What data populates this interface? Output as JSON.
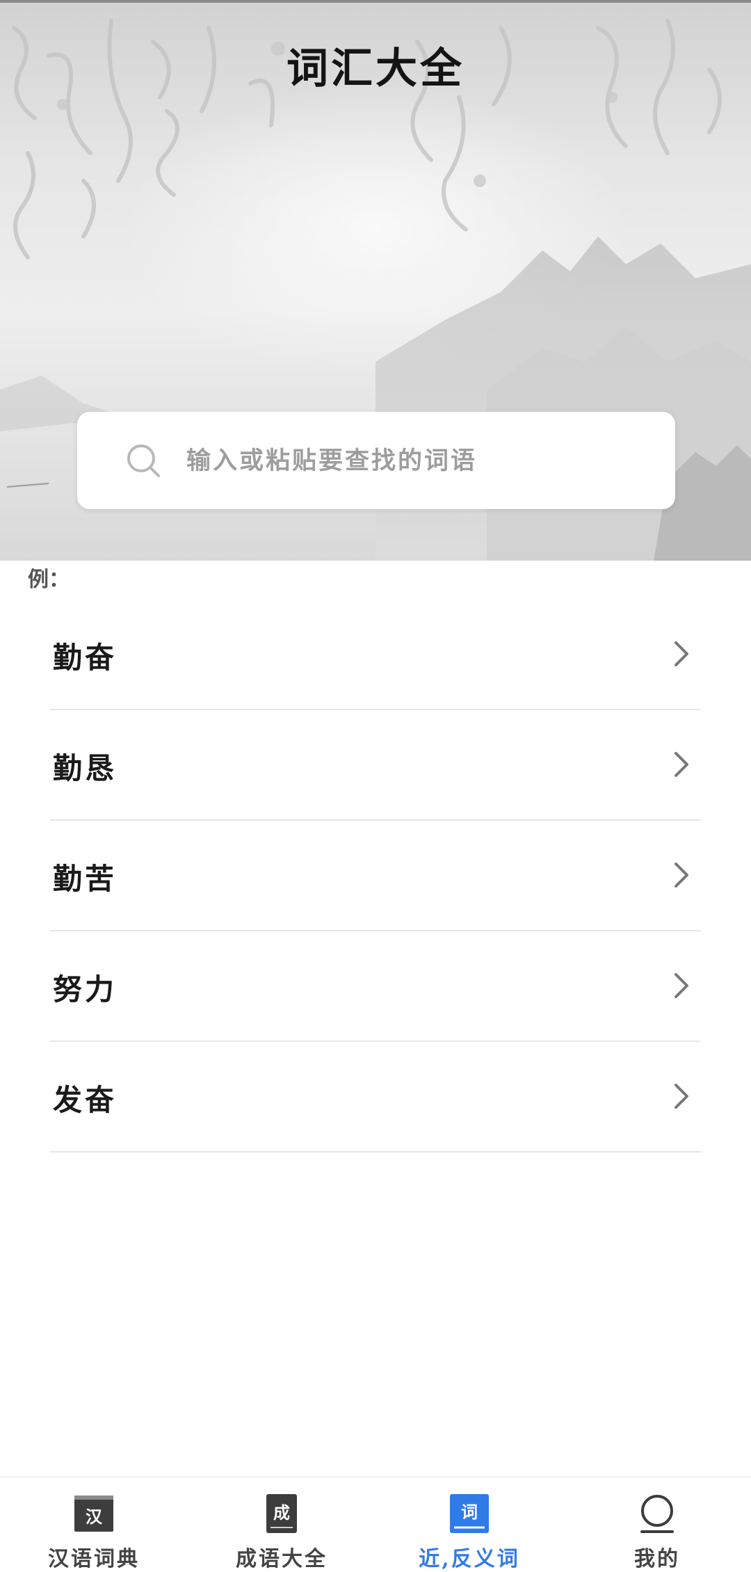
{
  "header": {
    "title": "词汇大全"
  },
  "search": {
    "placeholder": "输入或粘贴要查找的词语"
  },
  "examples": {
    "label": "例：",
    "items": [
      {
        "word": "勤奋"
      },
      {
        "word": "勤恳"
      },
      {
        "word": "勤苦"
      },
      {
        "word": "努力"
      },
      {
        "word": "发奋"
      }
    ]
  },
  "nav": {
    "active_color": "#2f7be8",
    "items": [
      {
        "label": "汉语词典",
        "icon_text": "汉",
        "icon": "book-icon"
      },
      {
        "label": "成语大全",
        "icon_text": "成",
        "icon": "book-icon"
      },
      {
        "label": "近,反义词",
        "icon_text": "词",
        "icon": "book-icon",
        "active": true
      },
      {
        "label": "我的",
        "icon": "profile-icon"
      }
    ]
  }
}
